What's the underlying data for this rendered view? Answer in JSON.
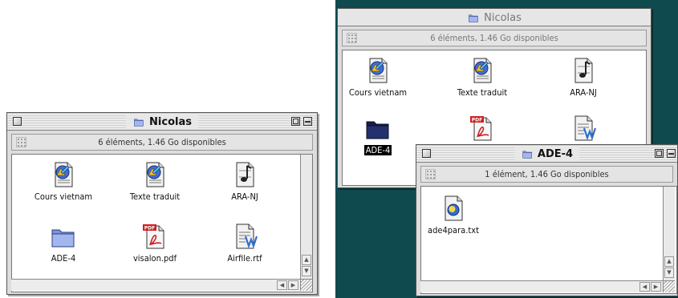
{
  "left_shot": {
    "window": {
      "title": "Nicolas",
      "info": "6 éléments, 1.46 Go disponibles",
      "items": [
        {
          "label": "Cours vietnam",
          "icon": "document-icon"
        },
        {
          "label": "Texte traduit",
          "icon": "document-icon"
        },
        {
          "label": "ARA-NJ",
          "icon": "music-document-icon"
        },
        {
          "label": "ADE-4",
          "icon": "folder-icon"
        },
        {
          "label": "visalon.pdf",
          "icon": "pdf-icon"
        },
        {
          "label": "Airfile.rtf",
          "icon": "rtf-icon"
        }
      ]
    }
  },
  "right_shot": {
    "back_window": {
      "title": "Nicolas",
      "info": "6 éléments, 1.46 Go disponibles",
      "items": [
        {
          "label": "Cours vietnam",
          "icon": "document-icon"
        },
        {
          "label": "Texte traduit",
          "icon": "document-icon"
        },
        {
          "label": "ARA-NJ",
          "icon": "music-document-icon"
        },
        {
          "label": "ADE-4",
          "icon": "folder-icon",
          "selected": true
        },
        {
          "label": "",
          "icon": "pdf-icon"
        },
        {
          "label": "",
          "icon": "rtf-icon"
        }
      ]
    },
    "front_window": {
      "title": "ADE-4",
      "info": "1 élément, 1.46 Go disponibles",
      "items": [
        {
          "label": "ade4para.txt",
          "icon": "text-file-icon"
        }
      ]
    }
  },
  "colors": {
    "desktop": "#0e4a4e",
    "window_chrome": "#dddddd",
    "folder": "#8fa6e0",
    "folder_selected": "#1f2a66",
    "pdf_red": "#cc1f1f"
  }
}
